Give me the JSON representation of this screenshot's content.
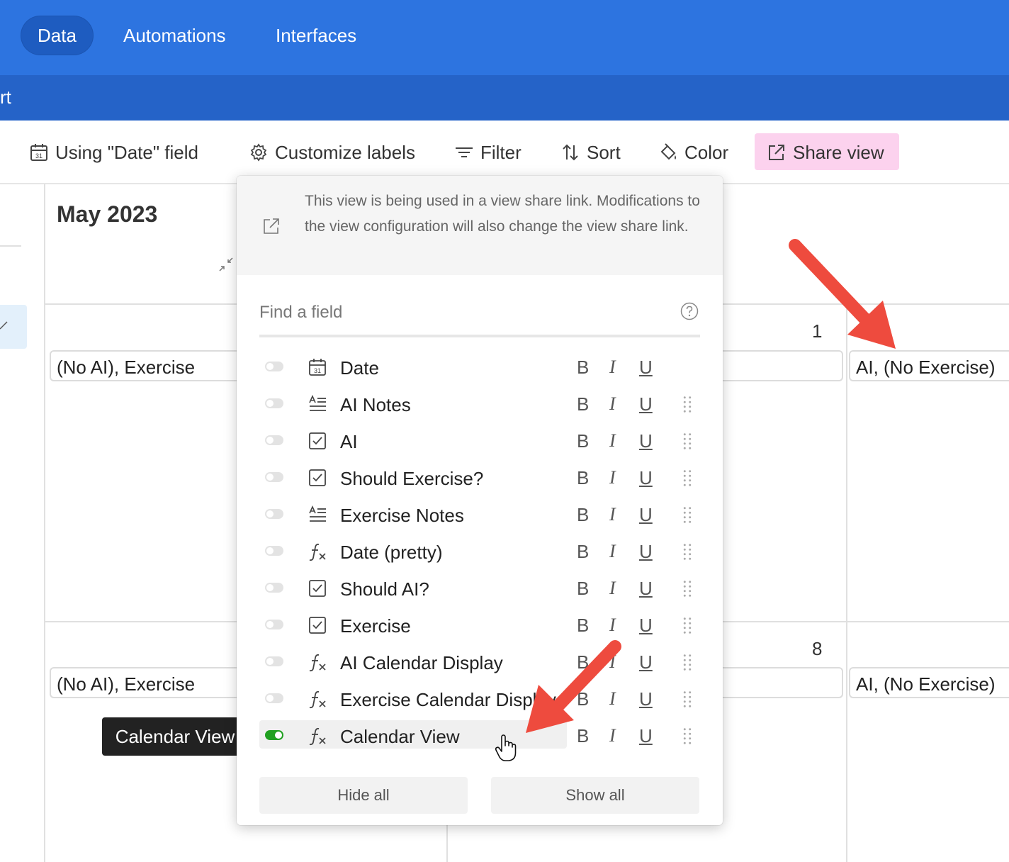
{
  "nav": {
    "tabs": [
      {
        "label": "Data",
        "active": true
      },
      {
        "label": "Automations",
        "active": false
      },
      {
        "label": "Interfaces",
        "active": false
      }
    ],
    "sub_text": "rt"
  },
  "toolbar": {
    "date_field": "Using \"Date\" field",
    "customize": "Customize labels",
    "filter": "Filter",
    "sort": "Sort",
    "color": "Color",
    "share": "Share view"
  },
  "calendar": {
    "month": "May 2023",
    "days": [
      "1",
      "8"
    ],
    "events": [
      "(No AI), Exercise",
      "AI, (No Exercise)",
      "(No AI), Exercise",
      "AI, (No Exercise)"
    ]
  },
  "tooltip": "Calendar View",
  "popup": {
    "notice": "This view is being used in a view share link. Modifications to the view configuration will also change the view share link.",
    "search_placeholder": "Find a field",
    "fields": [
      {
        "label": "Date",
        "icon": "calendar-icon",
        "enabled": false
      },
      {
        "label": "AI Notes",
        "icon": "long-text-icon",
        "enabled": false
      },
      {
        "label": "AI",
        "icon": "checkbox-icon",
        "enabled": false
      },
      {
        "label": "Should Exercise?",
        "icon": "checkbox-icon",
        "enabled": false
      },
      {
        "label": "Exercise Notes",
        "icon": "long-text-icon",
        "enabled": false
      },
      {
        "label": "Date (pretty)",
        "icon": "formula-icon",
        "enabled": false
      },
      {
        "label": "Should AI?",
        "icon": "checkbox-icon",
        "enabled": false
      },
      {
        "label": "Exercise",
        "icon": "checkbox-icon",
        "enabled": false
      },
      {
        "label": "AI Calendar Display",
        "icon": "formula-icon",
        "enabled": false
      },
      {
        "label": "Exercise Calendar Display",
        "icon": "formula-icon",
        "enabled": false
      },
      {
        "label": "Calendar View",
        "icon": "formula-icon",
        "enabled": true
      }
    ],
    "format": {
      "bold": "B",
      "italic": "I",
      "underline": "U"
    },
    "hide_all": "Hide all",
    "show_all": "Show all"
  },
  "colors": {
    "nav": "#2d74e0",
    "share_bg": "#fcd2ee",
    "toggle_on": "#20a020",
    "arrow": "#ee4b3e"
  }
}
